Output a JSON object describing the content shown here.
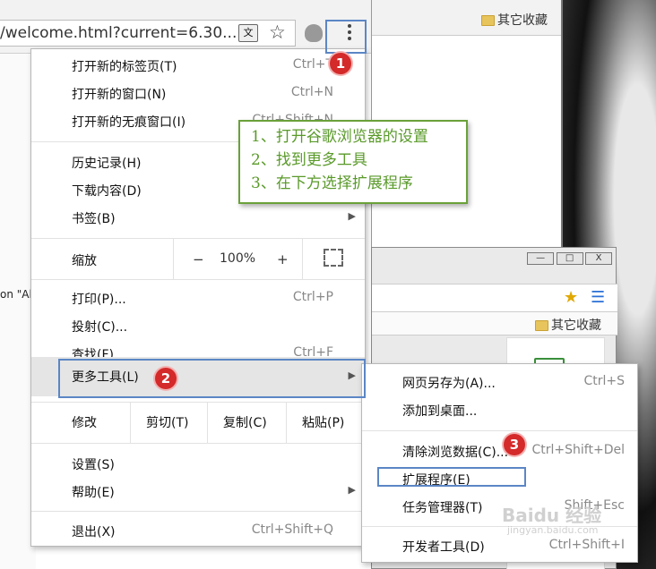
{
  "browser": {
    "url": "/welcome.html?current=6.30...",
    "translate_icon": "translate-icon",
    "star_icon": "star-icon",
    "menu_icon": "more-vert-icon"
  },
  "page_snippet": "on \"Al",
  "right_browser": {
    "bookmark_label": "其它收藏"
  },
  "window2": {
    "controls": [
      "—",
      "□",
      "X"
    ],
    "bookmark_label": "其它收藏"
  },
  "main_menu": {
    "items": [
      {
        "label": "打开新的标签页(T)",
        "shortcut": "Ctrl+T"
      },
      {
        "label": "打开新的窗口(N)",
        "shortcut": "Ctrl+N"
      },
      {
        "label": "打开新的无痕窗口(I)",
        "shortcut": "Ctrl+Shift+N"
      },
      {
        "label": "历史记录(H)"
      },
      {
        "label": "下载内容(D)"
      },
      {
        "label": "书签(B)"
      },
      {
        "label": "打印(P)...",
        "shortcut": "Ctrl+P"
      },
      {
        "label": "投射(C)..."
      },
      {
        "label": "查找(F)...",
        "shortcut": "Ctrl+F"
      },
      {
        "label": "更多工具(L)"
      },
      {
        "label": "设置(S)"
      },
      {
        "label": "帮助(E)"
      },
      {
        "label": "退出(X)",
        "shortcut": "Ctrl+Shift+Q"
      }
    ],
    "zoom": {
      "label": "缩放",
      "minus": "−",
      "value": "100%",
      "plus": "+"
    },
    "edit": {
      "label": "修改",
      "cut": "剪切(T)",
      "copy": "复制(C)",
      "paste": "粘贴(P)"
    }
  },
  "sub_menu": {
    "items": [
      {
        "label": "网页另存为(A)...",
        "shortcut": "Ctrl+S"
      },
      {
        "label": "添加到桌面..."
      },
      {
        "label": "清除浏览数据(C)...",
        "shortcut": "Ctrl+Shift+Del"
      },
      {
        "label": "扩展程序(E)"
      },
      {
        "label": "任务管理器(T)",
        "shortcut": "Shift+Esc"
      },
      {
        "label": "开发者工具(D)",
        "shortcut": "Ctrl+Shift+I"
      }
    ]
  },
  "annotations": {
    "badges": [
      "1",
      "2",
      "3"
    ],
    "note_lines": [
      "1、打开谷歌浏览器的设置",
      "2、找到更多工具",
      "3、在下方选择扩展程序"
    ],
    "box_color": "#5b86c5",
    "note_color": "#6aa13a",
    "badge_color": "#d42a2a"
  },
  "watermark": {
    "main": "Baidu 经验",
    "sub": "jingyan.baidu.com"
  }
}
